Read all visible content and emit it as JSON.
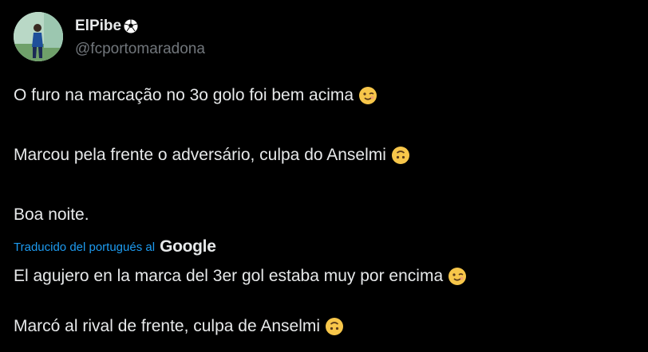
{
  "author": {
    "name": "ElPibe",
    "name_icon": "soccer-ball-icon",
    "handle": "@fcportomaradona"
  },
  "original": {
    "line1": "O furo na marcação no 3o golo foi bem acima",
    "line1_emoji": "winking-face-icon",
    "line2": "Marcou pela frente o adversário, culpa do Anselmi",
    "line2_emoji": "upside-down-face-icon",
    "line3": "Boa noite."
  },
  "translation": {
    "label": "Traducido del portugués al",
    "provider": "Google",
    "line1": "El agujero en la marca del 3er gol estaba muy por encima",
    "line1_emoji": "winking-face-icon",
    "line2": "Marcó al rival de frente, culpa de Anselmi",
    "line2_emoji": "upside-down-face-icon"
  },
  "colors": {
    "background": "#000000",
    "text": "#e7e9ea",
    "secondary": "#71767b",
    "link": "#1d9bf0"
  }
}
